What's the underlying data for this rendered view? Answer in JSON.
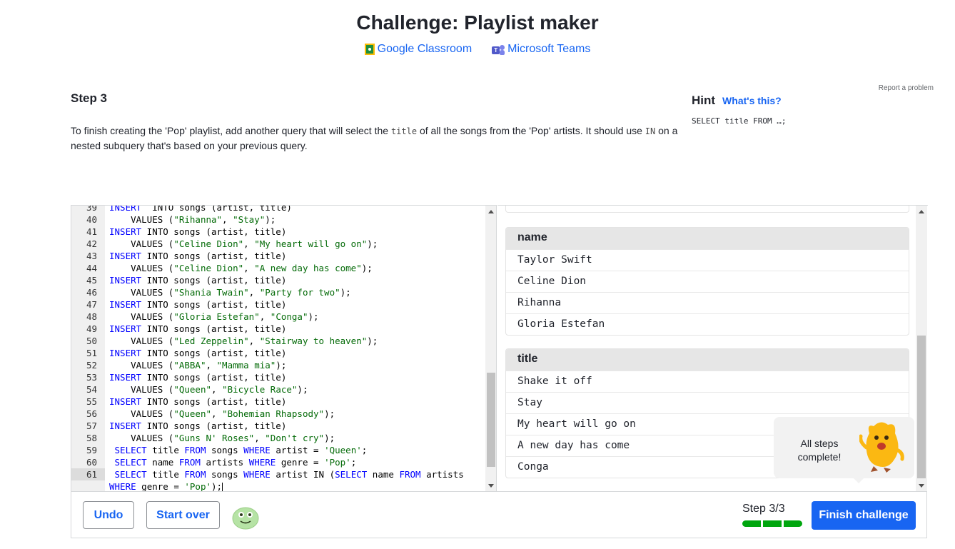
{
  "header": {
    "title": "Challenge: Playlist maker",
    "share": [
      {
        "label": "Google Classroom",
        "icon": "google-classroom-icon"
      },
      {
        "label": "Microsoft Teams",
        "icon": "microsoft-teams-icon"
      }
    ]
  },
  "step": {
    "title": "Step 3",
    "desc_part1": "To finish creating the 'Pop' playlist, add another query that will select the ",
    "desc_code1": "title",
    "desc_part2": " of all the songs from the 'Pop' artists. It should use ",
    "desc_code2": "IN",
    "desc_part3": " on a nested subquery that's based on your previous query."
  },
  "report_link": "Report a problem",
  "hint": {
    "title": "Hint",
    "whats_this": "What's this?",
    "code": "SELECT title FROM …;"
  },
  "editor": {
    "lines": [
      {
        "n": "39",
        "t": [
          [
            "kw",
            "INSERT"
          ],
          [
            "",
            "  INTO songs (artist, title)"
          ]
        ]
      },
      {
        "n": "40",
        "t": [
          [
            "",
            "    VALUES ("
          ],
          [
            "str",
            "\"Rihanna\""
          ],
          [
            "",
            ", "
          ],
          [
            "str",
            "\"Stay\""
          ],
          [
            "",
            ");"
          ]
        ]
      },
      {
        "n": "41",
        "t": [
          [
            "kw",
            "INSERT"
          ],
          [
            "",
            " INTO songs (artist, title)"
          ]
        ]
      },
      {
        "n": "42",
        "t": [
          [
            "",
            "    VALUES ("
          ],
          [
            "str",
            "\"Celine Dion\""
          ],
          [
            "",
            ", "
          ],
          [
            "str",
            "\"My heart will go on\""
          ],
          [
            "",
            ");"
          ]
        ]
      },
      {
        "n": "43",
        "t": [
          [
            "kw",
            "INSERT"
          ],
          [
            "",
            " INTO songs (artist, title)"
          ]
        ]
      },
      {
        "n": "44",
        "t": [
          [
            "",
            "    VALUES ("
          ],
          [
            "str",
            "\"Celine Dion\""
          ],
          [
            "",
            ", "
          ],
          [
            "str",
            "\"A new day has come\""
          ],
          [
            "",
            ");"
          ]
        ]
      },
      {
        "n": "45",
        "t": [
          [
            "kw",
            "INSERT"
          ],
          [
            "",
            " INTO songs (artist, title)"
          ]
        ]
      },
      {
        "n": "46",
        "t": [
          [
            "",
            "    VALUES ("
          ],
          [
            "str",
            "\"Shania Twain\""
          ],
          [
            "",
            ", "
          ],
          [
            "str",
            "\"Party for two\""
          ],
          [
            "",
            ");"
          ]
        ]
      },
      {
        "n": "47",
        "t": [
          [
            "kw",
            "INSERT"
          ],
          [
            "",
            " INTO songs (artist, title)"
          ]
        ]
      },
      {
        "n": "48",
        "t": [
          [
            "",
            "    VALUES ("
          ],
          [
            "str",
            "\"Gloria Estefan\""
          ],
          [
            "",
            ", "
          ],
          [
            "str",
            "\"Conga\""
          ],
          [
            "",
            ");"
          ]
        ]
      },
      {
        "n": "49",
        "t": [
          [
            "kw",
            "INSERT"
          ],
          [
            "",
            " INTO songs (artist, title)"
          ]
        ]
      },
      {
        "n": "50",
        "t": [
          [
            "",
            "    VALUES ("
          ],
          [
            "str",
            "\"Led Zeppelin\""
          ],
          [
            "",
            ", "
          ],
          [
            "str",
            "\"Stairway to heaven\""
          ],
          [
            "",
            ");"
          ]
        ]
      },
      {
        "n": "51",
        "t": [
          [
            "kw",
            "INSERT"
          ],
          [
            "",
            " INTO songs (artist, title)"
          ]
        ]
      },
      {
        "n": "52",
        "t": [
          [
            "",
            "    VALUES ("
          ],
          [
            "str",
            "\"ABBA\""
          ],
          [
            "",
            ", "
          ],
          [
            "str",
            "\"Mamma mia\""
          ],
          [
            "",
            ");"
          ]
        ]
      },
      {
        "n": "53",
        "t": [
          [
            "kw",
            "INSERT"
          ],
          [
            "",
            " INTO songs (artist, title)"
          ]
        ]
      },
      {
        "n": "54",
        "t": [
          [
            "",
            "    VALUES ("
          ],
          [
            "str",
            "\"Queen\""
          ],
          [
            "",
            ", "
          ],
          [
            "str",
            "\"Bicycle Race\""
          ],
          [
            "",
            ");"
          ]
        ]
      },
      {
        "n": "55",
        "t": [
          [
            "kw",
            "INSERT"
          ],
          [
            "",
            " INTO songs (artist, title)"
          ]
        ]
      },
      {
        "n": "56",
        "t": [
          [
            "",
            "    VALUES ("
          ],
          [
            "str",
            "\"Queen\""
          ],
          [
            "",
            ", "
          ],
          [
            "str",
            "\"Bohemian Rhapsody\""
          ],
          [
            "",
            ");"
          ]
        ]
      },
      {
        "n": "57",
        "t": [
          [
            "kw",
            "INSERT"
          ],
          [
            "",
            " INTO songs (artist, title)"
          ]
        ]
      },
      {
        "n": "58",
        "t": [
          [
            "",
            "    VALUES ("
          ],
          [
            "str",
            "\"Guns N' Roses\""
          ],
          [
            "",
            ", "
          ],
          [
            "str",
            "\"Don't cry\""
          ],
          [
            "",
            ");"
          ]
        ]
      },
      {
        "n": "59",
        "t": [
          [
            "",
            " "
          ],
          [
            "kw",
            "SELECT"
          ],
          [
            "",
            " title "
          ],
          [
            "kw",
            "FROM"
          ],
          [
            "",
            " songs "
          ],
          [
            "kw",
            "WHERE"
          ],
          [
            "",
            " artist = "
          ],
          [
            "str",
            "'Queen'"
          ],
          [
            "",
            ";"
          ]
        ]
      },
      {
        "n": "60",
        "t": [
          [
            "",
            " "
          ],
          [
            "kw",
            "SELECT"
          ],
          [
            "",
            " name "
          ],
          [
            "kw",
            "FROM"
          ],
          [
            "",
            " artists "
          ],
          [
            "kw",
            "WHERE"
          ],
          [
            "",
            " genre = "
          ],
          [
            "str",
            "'Pop'"
          ],
          [
            "",
            ";"
          ]
        ]
      },
      {
        "n": "61",
        "t": [
          [
            "",
            " "
          ],
          [
            "kw",
            "SELECT"
          ],
          [
            "",
            " title "
          ],
          [
            "kw",
            "FROM"
          ],
          [
            "",
            " songs "
          ],
          [
            "kw",
            "WHERE"
          ],
          [
            "",
            " artist IN ("
          ],
          [
            "kw",
            "SELECT"
          ],
          [
            "",
            " name "
          ],
          [
            "kw",
            "FROM"
          ],
          [
            "",
            " artists"
          ]
        ],
        "active": true
      },
      {
        "n": "",
        "t": [
          [
            "kw",
            "WHERE"
          ],
          [
            "",
            " genre = "
          ],
          [
            "str",
            "'Pop'"
          ],
          [
            "",
            ");"
          ]
        ],
        "cursor": true
      }
    ]
  },
  "results": {
    "partial_text": "...",
    "tables": [
      {
        "header": "name",
        "rows": [
          "Taylor Swift",
          "Celine Dion",
          "Rihanna",
          "Gloria Estefan"
        ]
      },
      {
        "header": "title",
        "rows": [
          "Shake it off",
          "Stay",
          "My heart will go on",
          "A new day has come",
          "Conga"
        ]
      }
    ]
  },
  "bubble": {
    "text": "All steps complete!"
  },
  "footer": {
    "undo": "Undo",
    "start_over": "Start over",
    "step_count": "Step 3/3",
    "steps_completed": 3,
    "steps_total": 3,
    "finish": "Finish challenge"
  },
  "colors": {
    "accent": "#1865f2",
    "progress": "#00a60e",
    "keyword": "#0000ff",
    "string": "#036a07"
  }
}
